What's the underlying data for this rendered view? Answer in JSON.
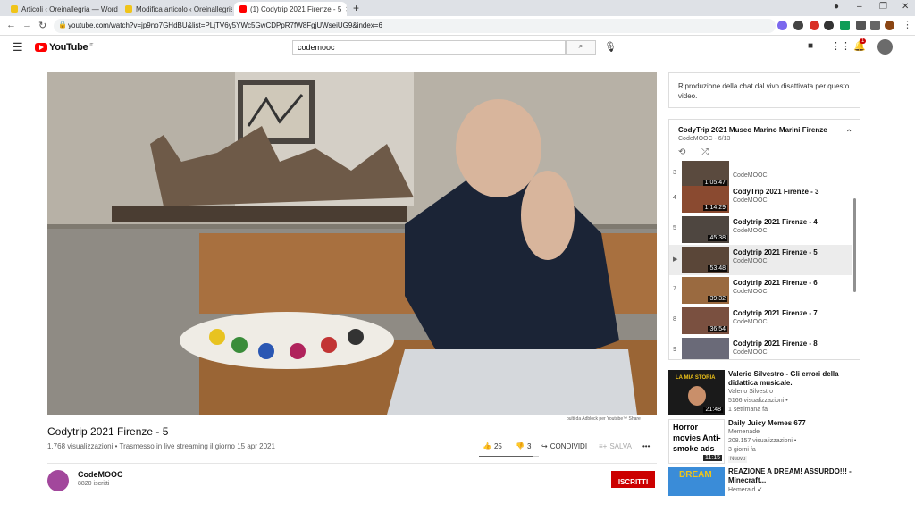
{
  "browser": {
    "tabs": [
      {
        "title": "Articoli ‹ Oreinallegria — WordPress"
      },
      {
        "title": "Modifica articolo ‹ Oreinallegria"
      },
      {
        "title": "(1) Codytrip 2021 Firenze - 5"
      }
    ],
    "new_tab": "+",
    "url": "youtube.com/watch?v=jp9no7GHdBU&list=PLjTV6y5YWc5GwCDPpR7fW8FgjUWseiUG9&index=6",
    "colors": {
      "tabbar": "#dee1e6",
      "active_tab": "#ffffff"
    }
  },
  "youtube": {
    "logo_text": "YouTube",
    "logo_suffix": "IT",
    "search_value": "codemooc",
    "notification_count": "1",
    "accent": "#ff0000"
  },
  "video": {
    "title": "Codytrip 2021 Firenze - 5",
    "stats": "1.768 visualizzazioni • Trasmesso in live streaming il giorno 15 apr 2021",
    "likes": "25",
    "dislikes": "3",
    "share_label": "CONDIVIDI",
    "save_label": "SALVA",
    "more_label": "•••",
    "watermark": "pulti da Adblock per Youtube™ Share"
  },
  "channel": {
    "name": "CodeMOOC",
    "subscribers": "8820 iscritti",
    "subscribe_label": "ISCRITTI",
    "avatar_color": "#a2479c"
  },
  "chat": {
    "notice": "Riproduzione della chat dal vivo disattivata per questo video."
  },
  "playlist": {
    "title": "CodyTrip 2021 Museo Marino Marini Firenze",
    "subtitle": "CodeMOOC - 6/13",
    "items": [
      {
        "index": "3",
        "title": "",
        "channel": "CodeMOOC",
        "duration": "1:05:47"
      },
      {
        "index": "4",
        "title": "CodyTrip 2021 Firenze - 3",
        "channel": "CodeMOOC",
        "duration": "1:14:29"
      },
      {
        "index": "5",
        "title": "Codytrip 2021 Firenze - 4",
        "channel": "CodeMOOC",
        "duration": "45:38"
      },
      {
        "index": "▶",
        "title": "Codytrip 2021 Firenze - 5",
        "channel": "CodeMOOC",
        "duration": "53:48"
      },
      {
        "index": "7",
        "title": "Codytrip 2021 Firenze - 6",
        "channel": "CodeMOOC",
        "duration": "39:32"
      },
      {
        "index": "8",
        "title": "Codytrip 2021 Firenze - 7",
        "channel": "CodeMOOC",
        "duration": "36:54"
      },
      {
        "index": "9",
        "title": "Codytrip 2021 Firenze - 8",
        "channel": "CodeMOOC",
        "duration": ""
      }
    ]
  },
  "recommendations": [
    {
      "title": "Valerio Silvestro - Gli errori della didattica musicale.",
      "meta1": "Valerio Silvestro",
      "meta2": "5166 visualizzazioni •",
      "meta3": "1 settimana fa",
      "duration": "21:48",
      "thumb_text": "LA MIA STORIA",
      "badge": ""
    },
    {
      "title": "Daily Juicy Memes 677",
      "meta1": "Memenade",
      "meta2": "208.157 visualizzazioni •",
      "meta3": "3 giorni fa",
      "duration": "11:15",
      "thumb_text": "Horror movies Anti-smoke ads",
      "badge": "Nuovo"
    },
    {
      "title": "REAZIONE A DREAM! ASSURDO!!! - Minecraft...",
      "meta1": "Hemerald ✔",
      "meta2": "",
      "meta3": "",
      "duration": "",
      "thumb_text": "DREAM",
      "badge": ""
    }
  ]
}
